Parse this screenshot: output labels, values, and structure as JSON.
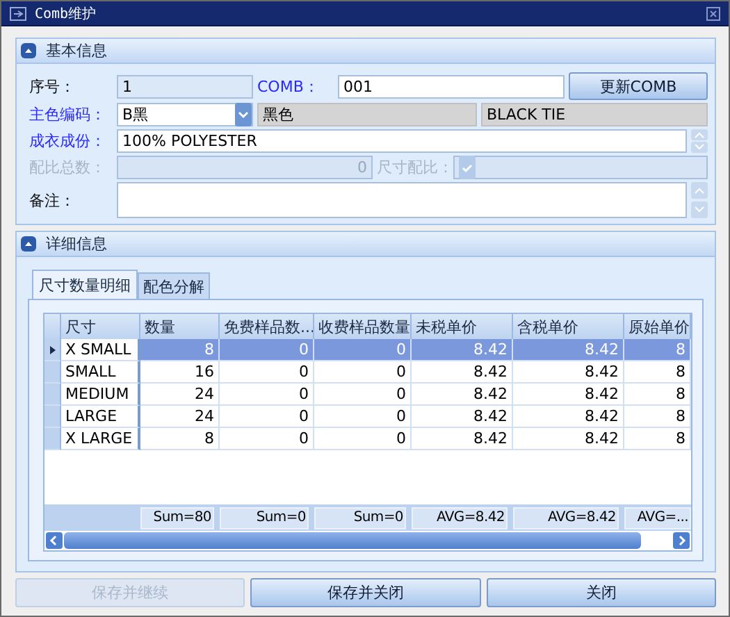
{
  "window": {
    "title": "Comb维护"
  },
  "basic_panel": {
    "title": "基本信息",
    "expanded": true
  },
  "form": {
    "seq": {
      "label": "序号：",
      "value": "1",
      "required": false
    },
    "comb": {
      "label": "COMB：",
      "value": "001",
      "required": true
    },
    "update_button": "更新COMB",
    "main_color": {
      "label": "主色编码：",
      "value": "B黑",
      "required": true
    },
    "color_name": "黑色",
    "color_english": "BLACK TIE",
    "composition": {
      "label": "成衣成份：",
      "value": "100% POLYESTER",
      "required": true
    },
    "ratio_total": {
      "label": "配比总数：",
      "value": "0",
      "disabled": true
    },
    "size_ratio": {
      "label": "尺寸配比：",
      "disabled": true
    },
    "remarks": {
      "label": "备注："
    }
  },
  "detail_panel": {
    "title": "详细信息",
    "expanded": true
  },
  "tabs": [
    {
      "label": "尺寸数量明细",
      "selected": true
    },
    {
      "label": "配色分解",
      "selected": false
    }
  ],
  "table": {
    "columns": [
      "尺寸",
      "数量",
      "免费样品数...",
      "收费样品数量",
      "未税单价",
      "含税单价",
      "原始单价"
    ],
    "rows": [
      {
        "selected": true,
        "cells": [
          "X SMALL",
          "8",
          "0",
          "0",
          "8.42",
          "8.42",
          "8"
        ]
      },
      {
        "selected": false,
        "cells": [
          "SMALL",
          "16",
          "0",
          "0",
          "8.42",
          "8.42",
          "8"
        ]
      },
      {
        "selected": false,
        "cells": [
          "MEDIUM",
          "24",
          "0",
          "0",
          "8.42",
          "8.42",
          "8"
        ]
      },
      {
        "selected": false,
        "cells": [
          "LARGE",
          "24",
          "0",
          "0",
          "8.42",
          "8.42",
          "8"
        ]
      },
      {
        "selected": false,
        "cells": [
          "X LARGE",
          "8",
          "0",
          "0",
          "8.42",
          "8.42",
          "8"
        ]
      }
    ],
    "footer": [
      "Sum=80",
      "Sum=0",
      "Sum=0",
      "AVG=8.42",
      "AVG=8.42",
      "AVG=..."
    ]
  },
  "buttons": [
    {
      "label": "保存并继续",
      "disabled": true
    },
    {
      "label": "保存并关闭",
      "disabled": false
    },
    {
      "label": "关闭",
      "disabled": false
    }
  ]
}
